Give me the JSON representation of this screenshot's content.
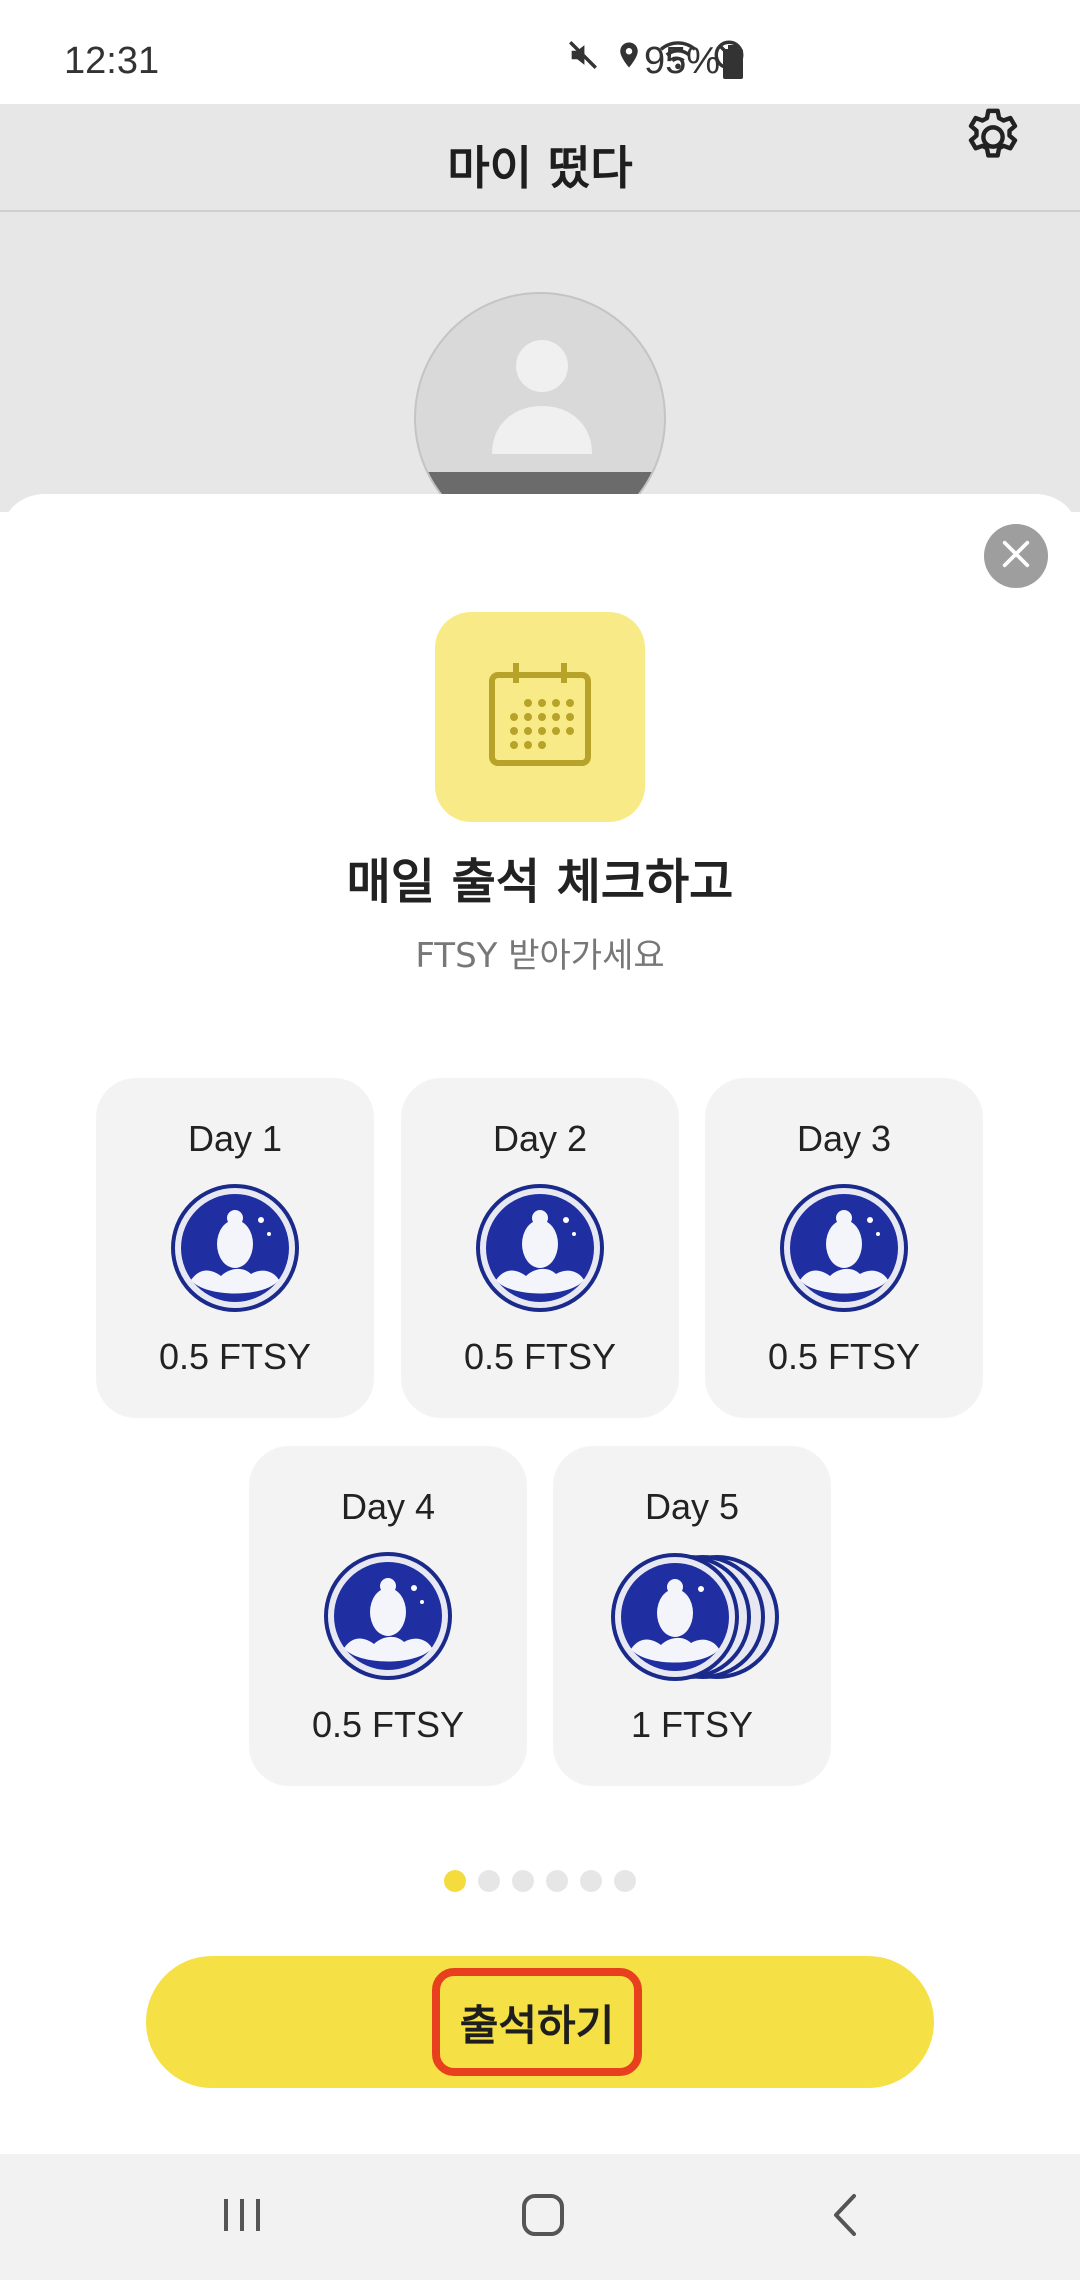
{
  "status_bar": {
    "time": "12:31",
    "battery": "95%",
    "icons": [
      "mute-icon",
      "location-icon",
      "wifi-icon",
      "do-not-disturb-icon",
      "battery-icon"
    ]
  },
  "app_bar": {
    "title": "마이 떴다",
    "settings_icon": "gear-icon"
  },
  "sheet": {
    "close_icon": "close-icon",
    "calendar_icon": "calendar-icon",
    "headline": "매일 출석 체크하고",
    "subline": "FTSY 받아가세요",
    "days": [
      {
        "label": "Day 1",
        "reward": "0.5 FTSY"
      },
      {
        "label": "Day 2",
        "reward": "0.5 FTSY"
      },
      {
        "label": "Day 3",
        "reward": "0.5 FTSY"
      },
      {
        "label": "Day 4",
        "reward": "0.5 FTSY"
      },
      {
        "label": "Day 5",
        "reward": "1 FTSY"
      }
    ],
    "pagination": {
      "total": 6,
      "current": 1
    },
    "cta_label": "출석하기"
  },
  "colors": {
    "accent_yellow": "#f5e046",
    "tile_yellow": "#f8ea86",
    "highlight_red": "#e8401f",
    "coin_blue": "#1f2ea0"
  },
  "nav_bar": {
    "icons": [
      "recent-apps-icon",
      "home-icon",
      "back-icon"
    ]
  }
}
